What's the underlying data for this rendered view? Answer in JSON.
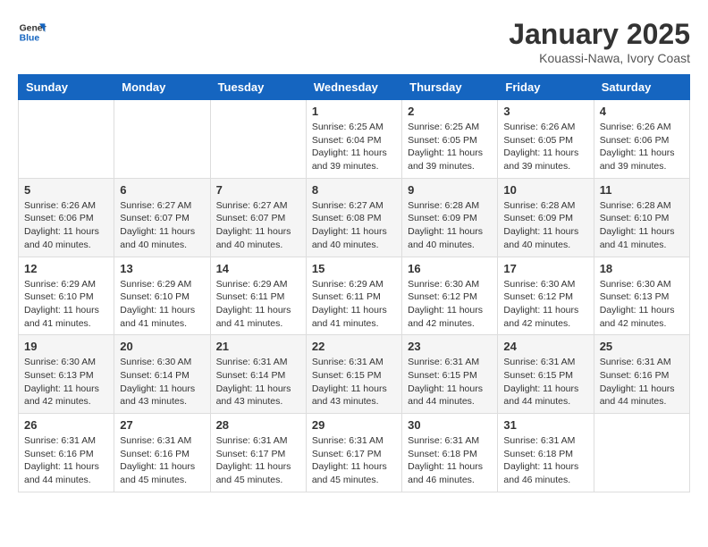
{
  "header": {
    "logo_line1": "General",
    "logo_line2": "Blue",
    "month_title": "January 2025",
    "subtitle": "Kouassi-Nawa, Ivory Coast"
  },
  "weekdays": [
    "Sunday",
    "Monday",
    "Tuesday",
    "Wednesday",
    "Thursday",
    "Friday",
    "Saturday"
  ],
  "weeks": [
    [
      {
        "day": "",
        "info": ""
      },
      {
        "day": "",
        "info": ""
      },
      {
        "day": "",
        "info": ""
      },
      {
        "day": "1",
        "info": "Sunrise: 6:25 AM\nSunset: 6:04 PM\nDaylight: 11 hours\nand 39 minutes."
      },
      {
        "day": "2",
        "info": "Sunrise: 6:25 AM\nSunset: 6:05 PM\nDaylight: 11 hours\nand 39 minutes."
      },
      {
        "day": "3",
        "info": "Sunrise: 6:26 AM\nSunset: 6:05 PM\nDaylight: 11 hours\nand 39 minutes."
      },
      {
        "day": "4",
        "info": "Sunrise: 6:26 AM\nSunset: 6:06 PM\nDaylight: 11 hours\nand 39 minutes."
      }
    ],
    [
      {
        "day": "5",
        "info": "Sunrise: 6:26 AM\nSunset: 6:06 PM\nDaylight: 11 hours\nand 40 minutes."
      },
      {
        "day": "6",
        "info": "Sunrise: 6:27 AM\nSunset: 6:07 PM\nDaylight: 11 hours\nand 40 minutes."
      },
      {
        "day": "7",
        "info": "Sunrise: 6:27 AM\nSunset: 6:07 PM\nDaylight: 11 hours\nand 40 minutes."
      },
      {
        "day": "8",
        "info": "Sunrise: 6:27 AM\nSunset: 6:08 PM\nDaylight: 11 hours\nand 40 minutes."
      },
      {
        "day": "9",
        "info": "Sunrise: 6:28 AM\nSunset: 6:09 PM\nDaylight: 11 hours\nand 40 minutes."
      },
      {
        "day": "10",
        "info": "Sunrise: 6:28 AM\nSunset: 6:09 PM\nDaylight: 11 hours\nand 40 minutes."
      },
      {
        "day": "11",
        "info": "Sunrise: 6:28 AM\nSunset: 6:10 PM\nDaylight: 11 hours\nand 41 minutes."
      }
    ],
    [
      {
        "day": "12",
        "info": "Sunrise: 6:29 AM\nSunset: 6:10 PM\nDaylight: 11 hours\nand 41 minutes."
      },
      {
        "day": "13",
        "info": "Sunrise: 6:29 AM\nSunset: 6:10 PM\nDaylight: 11 hours\nand 41 minutes."
      },
      {
        "day": "14",
        "info": "Sunrise: 6:29 AM\nSunset: 6:11 PM\nDaylight: 11 hours\nand 41 minutes."
      },
      {
        "day": "15",
        "info": "Sunrise: 6:29 AM\nSunset: 6:11 PM\nDaylight: 11 hours\nand 41 minutes."
      },
      {
        "day": "16",
        "info": "Sunrise: 6:30 AM\nSunset: 6:12 PM\nDaylight: 11 hours\nand 42 minutes."
      },
      {
        "day": "17",
        "info": "Sunrise: 6:30 AM\nSunset: 6:12 PM\nDaylight: 11 hours\nand 42 minutes."
      },
      {
        "day": "18",
        "info": "Sunrise: 6:30 AM\nSunset: 6:13 PM\nDaylight: 11 hours\nand 42 minutes."
      }
    ],
    [
      {
        "day": "19",
        "info": "Sunrise: 6:30 AM\nSunset: 6:13 PM\nDaylight: 11 hours\nand 42 minutes."
      },
      {
        "day": "20",
        "info": "Sunrise: 6:30 AM\nSunset: 6:14 PM\nDaylight: 11 hours\nand 43 minutes."
      },
      {
        "day": "21",
        "info": "Sunrise: 6:31 AM\nSunset: 6:14 PM\nDaylight: 11 hours\nand 43 minutes."
      },
      {
        "day": "22",
        "info": "Sunrise: 6:31 AM\nSunset: 6:15 PM\nDaylight: 11 hours\nand 43 minutes."
      },
      {
        "day": "23",
        "info": "Sunrise: 6:31 AM\nSunset: 6:15 PM\nDaylight: 11 hours\nand 44 minutes."
      },
      {
        "day": "24",
        "info": "Sunrise: 6:31 AM\nSunset: 6:15 PM\nDaylight: 11 hours\nand 44 minutes."
      },
      {
        "day": "25",
        "info": "Sunrise: 6:31 AM\nSunset: 6:16 PM\nDaylight: 11 hours\nand 44 minutes."
      }
    ],
    [
      {
        "day": "26",
        "info": "Sunrise: 6:31 AM\nSunset: 6:16 PM\nDaylight: 11 hours\nand 44 minutes."
      },
      {
        "day": "27",
        "info": "Sunrise: 6:31 AM\nSunset: 6:16 PM\nDaylight: 11 hours\nand 45 minutes."
      },
      {
        "day": "28",
        "info": "Sunrise: 6:31 AM\nSunset: 6:17 PM\nDaylight: 11 hours\nand 45 minutes."
      },
      {
        "day": "29",
        "info": "Sunrise: 6:31 AM\nSunset: 6:17 PM\nDaylight: 11 hours\nand 45 minutes."
      },
      {
        "day": "30",
        "info": "Sunrise: 6:31 AM\nSunset: 6:18 PM\nDaylight: 11 hours\nand 46 minutes."
      },
      {
        "day": "31",
        "info": "Sunrise: 6:31 AM\nSunset: 6:18 PM\nDaylight: 11 hours\nand 46 minutes."
      },
      {
        "day": "",
        "info": ""
      }
    ]
  ]
}
